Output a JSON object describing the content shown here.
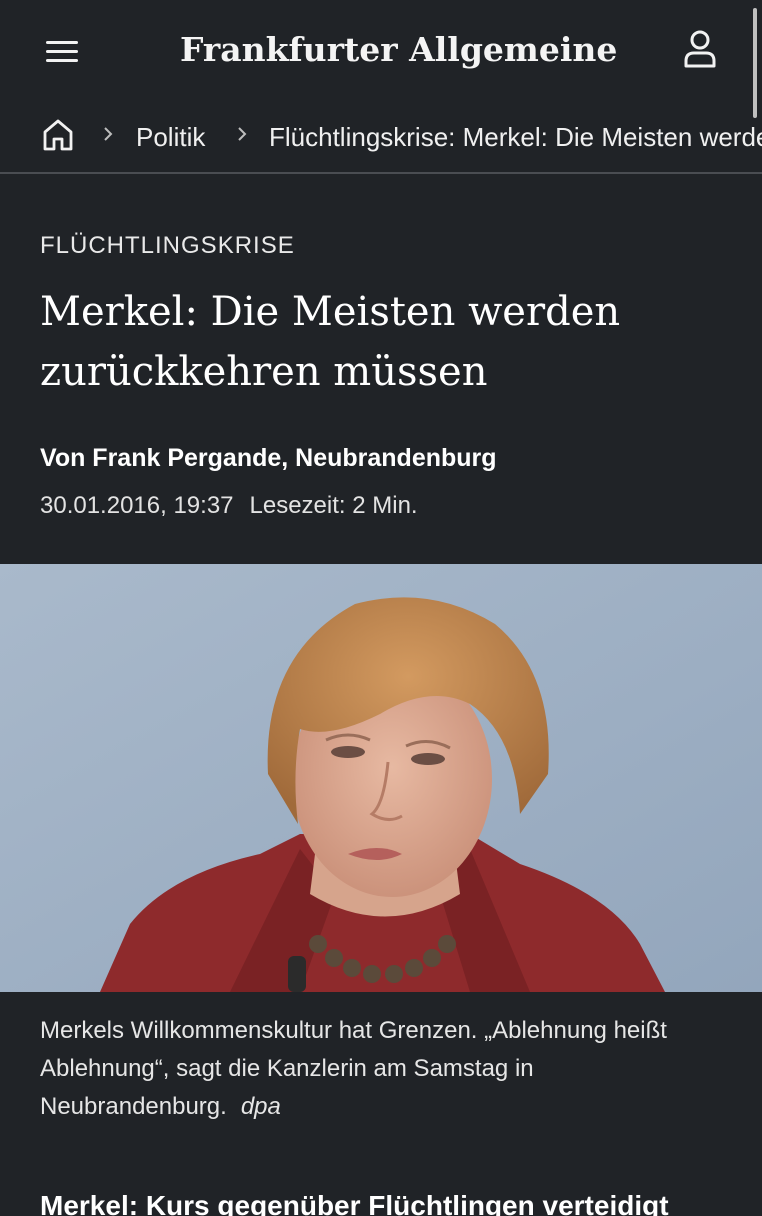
{
  "header": {
    "logo_text": "Frankfurter Allgemeine",
    "menu_icon": "hamburger-icon",
    "user_icon": "user-icon"
  },
  "breadcrumb": {
    "home_icon": "home-icon",
    "items": [
      {
        "label": "Politik"
      },
      {
        "label": "Flüchtlingskrise: Merkel: Die Meisten werden zurückkehren müssen"
      }
    ]
  },
  "article": {
    "kicker": "FLÜCHTLINGSKRISE",
    "headline": "Merkel: Die Meisten werden zurückkehren müssen",
    "byline": "Von Frank Pergande, Neubrandenburg",
    "date": "30.01.2016, 19:37",
    "reading_time": "Lesezeit: 2 Min.",
    "image": {
      "caption": "Merkels Willkommenskultur hat Grenzen. „Ablehnung heißt Ablehnung“, sagt die Kanzlerin am Samstag in Neubrandenburg.",
      "credit": "dpa"
    },
    "next_teaser": "Merkel: Kurs gegenüber Flüchtlingen verteidigt"
  },
  "colors": {
    "background": "#202327",
    "text": "#ffffff",
    "divider": "#4a4d52",
    "photo_background": "#9fb0c4",
    "jacket": "#8e2a2c"
  }
}
